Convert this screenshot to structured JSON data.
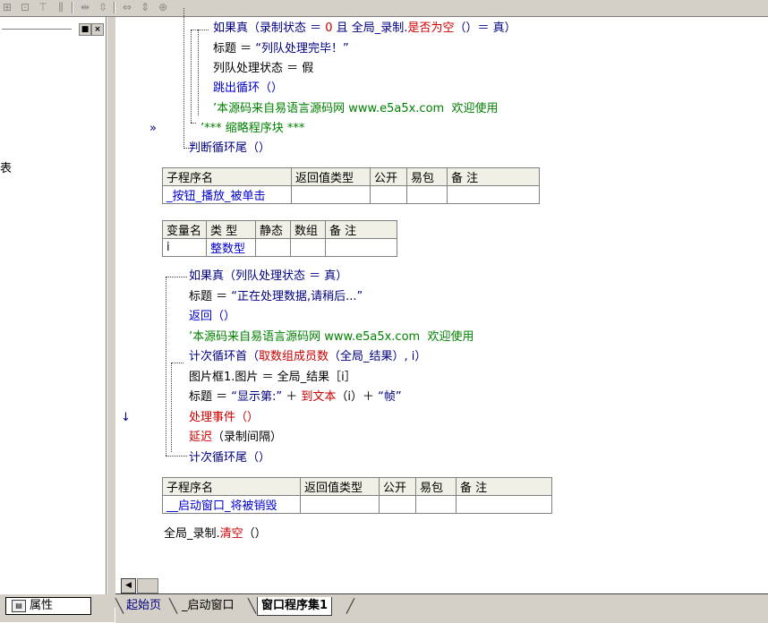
{
  "toolbar": {
    "icons": [
      "grid-icon",
      "layout-icon",
      "align-top-icon",
      "align-middle-icon",
      "spacing-h-icon",
      "spacing-v-icon",
      "resize-icon",
      "resize-v-icon",
      "resize-both-icon"
    ]
  },
  "left_panel": {
    "close_glyph": "×",
    "restore_glyph": "■",
    "clipped_char": "表",
    "properties_tab": "属性"
  },
  "code_block1": {
    "line1": {
      "prefix": "如果真（录制状态 ＝ ",
      "num": "0",
      "mid": " 且 全局_录制.",
      "call": "是否为空",
      "suffix": "（）＝ 真）"
    },
    "line2": {
      "left": "标题 ＝ ",
      "str": "“列队处理完毕！”"
    },
    "line3": "列队处理状态 ＝ 假",
    "line4": "跳出循环（）",
    "line5": "’本源码来自易语言源码网 www.e5a5x.com  欢迎使用",
    "line6": "’*** 缩略程序块 ***",
    "line7": "判断循环尾（）",
    "marker": "»"
  },
  "sub_table1": {
    "headers": [
      "子程序名",
      "返回值类型",
      "公开",
      "易包",
      "备 注"
    ],
    "row": [
      "_按钮_播放_被单击",
      "",
      "",
      "",
      ""
    ]
  },
  "var_table": {
    "headers": [
      "变量名",
      "类 型",
      "静态",
      "数组",
      "备 注"
    ],
    "row": [
      "i",
      "整数型",
      "",
      "",
      ""
    ]
  },
  "code_block2": {
    "line1": "如果真（列队处理状态 ＝ 真）",
    "line2": {
      "left": "标题 ＝ ",
      "str": "“正在处理数据,请稍后...”"
    },
    "line3": "返回（）",
    "line4": "’本源码来自易语言源码网 www.e5a5x.com  欢迎使用",
    "line5": {
      "a": "计次循环首（",
      "b": "取数组成员数",
      "c": "（全局_结果）, i）"
    },
    "line6": "图片框1.图片 ＝ 全局_结果［i］",
    "line7": {
      "left": "标题 ＝ ",
      "str1": "“显示第:”",
      "plus1": " ＋ ",
      "fn": "到文本",
      "args": "（i）＋ ",
      "str2": "“帧”"
    },
    "line8": "处理事件（）",
    "line9": {
      "fn": "延迟",
      "args": "（录制间隔）"
    },
    "line10": "计次循环尾（）",
    "arrow": "↓"
  },
  "sub_table2": {
    "headers": [
      "子程序名",
      "返回值类型",
      "公开",
      "易包",
      "备 注"
    ],
    "row": [
      "__启动窗口_将被销毁",
      "",
      "",
      "",
      ""
    ]
  },
  "code_block3": {
    "line1": {
      "obj": "全局_录制.",
      "fn": "清空",
      "args": "（）"
    }
  },
  "scrollbar": {
    "left_arrow": "◀"
  },
  "tabs": [
    "起始页",
    "_启动窗口",
    "窗口程序集1"
  ],
  "colors": {
    "chrome": "#d4d0c8",
    "keyword": "#000080",
    "function": "#0000cc",
    "red": "#cc0000",
    "comment": "#008000"
  }
}
